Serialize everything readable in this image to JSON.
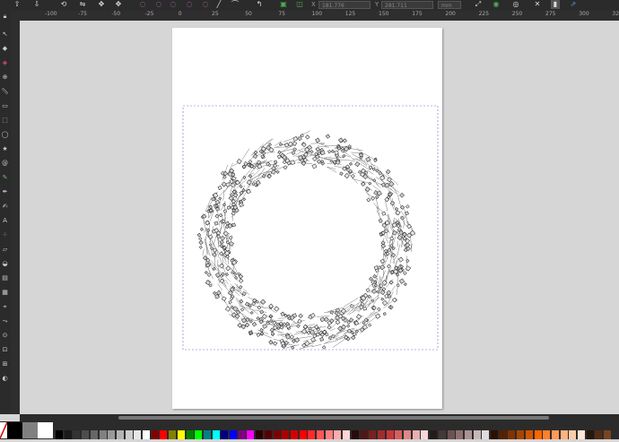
{
  "toolbar": {
    "x_field_value": "181.776",
    "y_field_value": "281.711",
    "unit": "mm",
    "icons": [
      "align-icon",
      "distribute-icon",
      "flip-icon",
      "snap-icon",
      "node-icon",
      "node-icon",
      "node-icon",
      "node-icon",
      "path-icon",
      "path-icon",
      "curve-icon",
      "corner-icon",
      "object-icon",
      "transform-icon"
    ]
  },
  "rulers": {
    "h_labels": [
      "-100",
      "-75",
      "-50",
      "-25",
      "0",
      "25",
      "50",
      "75",
      "100",
      "125",
      "150",
      "175",
      "200",
      "225",
      "250",
      "275",
      "300",
      "325"
    ]
  },
  "tools": {
    "icons": [
      "lock-icon",
      "selector-icon",
      "node-tool-icon",
      "zoom-icon",
      "measure-icon",
      "rect-icon",
      "ellipse-icon",
      "star-icon",
      "spiral-icon",
      "pencil-icon",
      "pen-icon",
      "calligraphy-icon",
      "text-icon",
      "spray-icon",
      "eraser-icon",
      "bucket-icon",
      "gradient-icon",
      "mesh-icon",
      "dropper-icon",
      "connector-icon",
      "tweak-icon",
      "pages-icon",
      "lpe-icon",
      "zoom-fit-icon",
      "zoom-page-icon",
      "zoom-draw-icon",
      "zoom-sel-icon",
      "view-icon"
    ]
  },
  "palette": {
    "colors": [
      "#000000",
      "#1a1a1a",
      "#333333",
      "#4d4d4d",
      "#666666",
      "#808080",
      "#999999",
      "#b3b3b3",
      "#cccccc",
      "#e6e6e6",
      "#ffffff",
      "#800000",
      "#ff0000",
      "#808000",
      "#ffff00",
      "#008000",
      "#00ff00",
      "#008080",
      "#00ffff",
      "#000080",
      "#0000ff",
      "#800080",
      "#ff00ff",
      "#2b0000",
      "#550000",
      "#800000",
      "#aa0000",
      "#d40000",
      "#ff0000",
      "#ff2a2a",
      "#ff5555",
      "#ff8080",
      "#ffaaaa",
      "#ffd5d5",
      "#280b0b",
      "#501616",
      "#782121",
      "#a02c2c",
      "#c83737",
      "#d35f5f",
      "#de8787",
      "#e9afaf",
      "#f4d7d7",
      "#241c1c",
      "#483737",
      "#6c5353",
      "#916f6f",
      "#ac9393",
      "#c8b7b7",
      "#e3dbdb",
      "#2b1100",
      "#552200",
      "#803300",
      "#aa4400",
      "#d45500",
      "#ff6600",
      "#ff7f2a",
      "#ff9955",
      "#ffb380",
      "#ffccaa",
      "#ffe6d5",
      "#28170b",
      "#502d16",
      "#784421"
    ]
  }
}
